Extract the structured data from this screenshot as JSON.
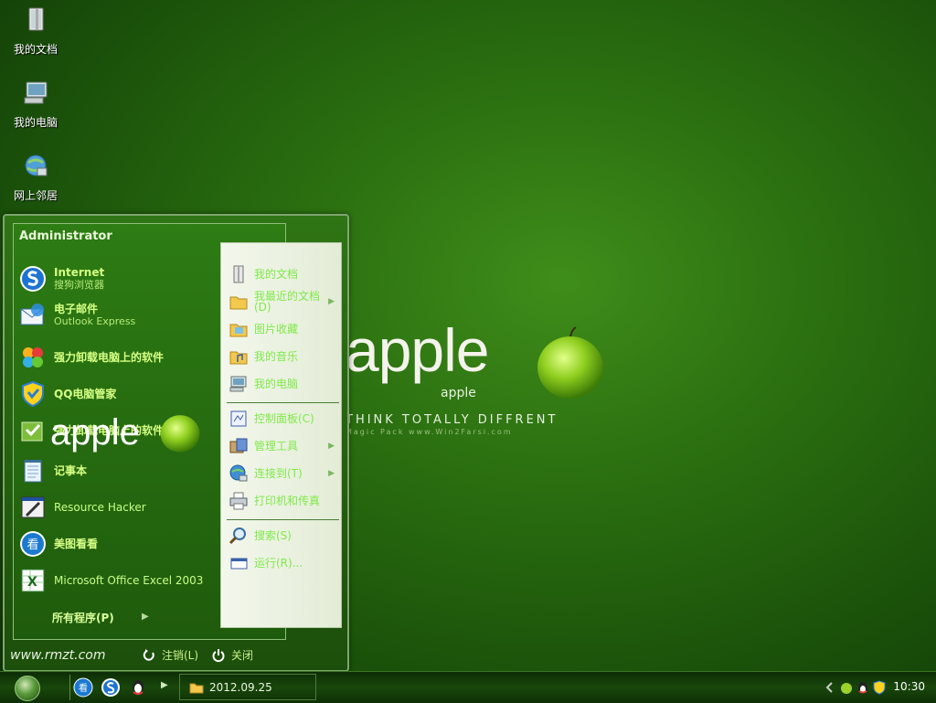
{
  "desktop": {
    "icons": [
      {
        "label": "我的文档",
        "icon": "my-documents-icon"
      },
      {
        "label": "我的电脑",
        "icon": "my-computer-icon"
      },
      {
        "label": "网上邻居",
        "icon": "network-places-icon"
      }
    ]
  },
  "wallpaper": {
    "logo_word": "apple",
    "logo_sub": "apple",
    "slogan": "THINK TOTALLY DIFFRENT",
    "small_text": "Magic Pack www.Win2Farsi.com"
  },
  "start_menu": {
    "user": "Administrator",
    "programs": [
      {
        "title": "Internet",
        "subtitle": "搜狗浏览器",
        "icon": "sogou-browser-icon"
      },
      {
        "title": "电子邮件",
        "subtitle": "Outlook Express",
        "icon": "outlook-express-icon"
      },
      {
        "title": "强力卸载电脑上的软件",
        "icon": "uninstaller-icon"
      },
      {
        "title": "QQ电脑管家",
        "icon": "qq-manager-icon"
      },
      {
        "title": "强力卸载电脑上的软件",
        "icon": "uninstaller-green-icon"
      },
      {
        "title": "记事本",
        "icon": "notepad-icon"
      },
      {
        "title": "Resource Hacker",
        "icon": "resource-hacker-icon"
      },
      {
        "title": "美图看看",
        "icon": "meitu-viewer-icon"
      },
      {
        "title": "Microsoft Office Excel 2003",
        "icon": "excel-icon"
      }
    ],
    "all_programs": "所有程序(P)",
    "inner_logo_word": "apple",
    "right_items": [
      {
        "label": "我的文档",
        "icon": "my-documents-icon"
      },
      {
        "label": "我最近的文档(D)",
        "icon": "recent-folder-icon",
        "arrow": true
      },
      {
        "label": "图片收藏",
        "icon": "pictures-folder-icon"
      },
      {
        "label": "我的音乐",
        "icon": "music-folder-icon"
      },
      {
        "label": "我的电脑",
        "icon": "my-computer-icon"
      },
      {
        "label": "控制面板(C)",
        "icon": "control-panel-icon"
      },
      {
        "label": "管理工具",
        "icon": "admin-tools-icon",
        "arrow": true
      },
      {
        "label": "连接到(T)",
        "icon": "connect-to-icon",
        "arrow": true
      },
      {
        "label": "打印机和传真",
        "icon": "printers-icon"
      },
      {
        "label": "搜索(S)",
        "icon": "search-icon"
      },
      {
        "label": "运行(R)...",
        "icon": "run-icon"
      }
    ],
    "footer": {
      "site": "www.rmzt.com",
      "logoff": "注销(L)",
      "shutdown": "关闭"
    }
  },
  "taskbar": {
    "task_label": "2012.09.25",
    "clock": "10:30",
    "quick_launch": [
      "show-desktop-icon",
      "sogou-browser-icon",
      "qq-icon"
    ],
    "tray": [
      "tray-expand-icon",
      "tray-apple-icon",
      "tray-qq-icon",
      "tray-shield-icon"
    ]
  },
  "colors": {
    "desktop_bg": "#2a6e10",
    "menu_text": "#c8ff86",
    "right_text": "#7fe94a"
  }
}
